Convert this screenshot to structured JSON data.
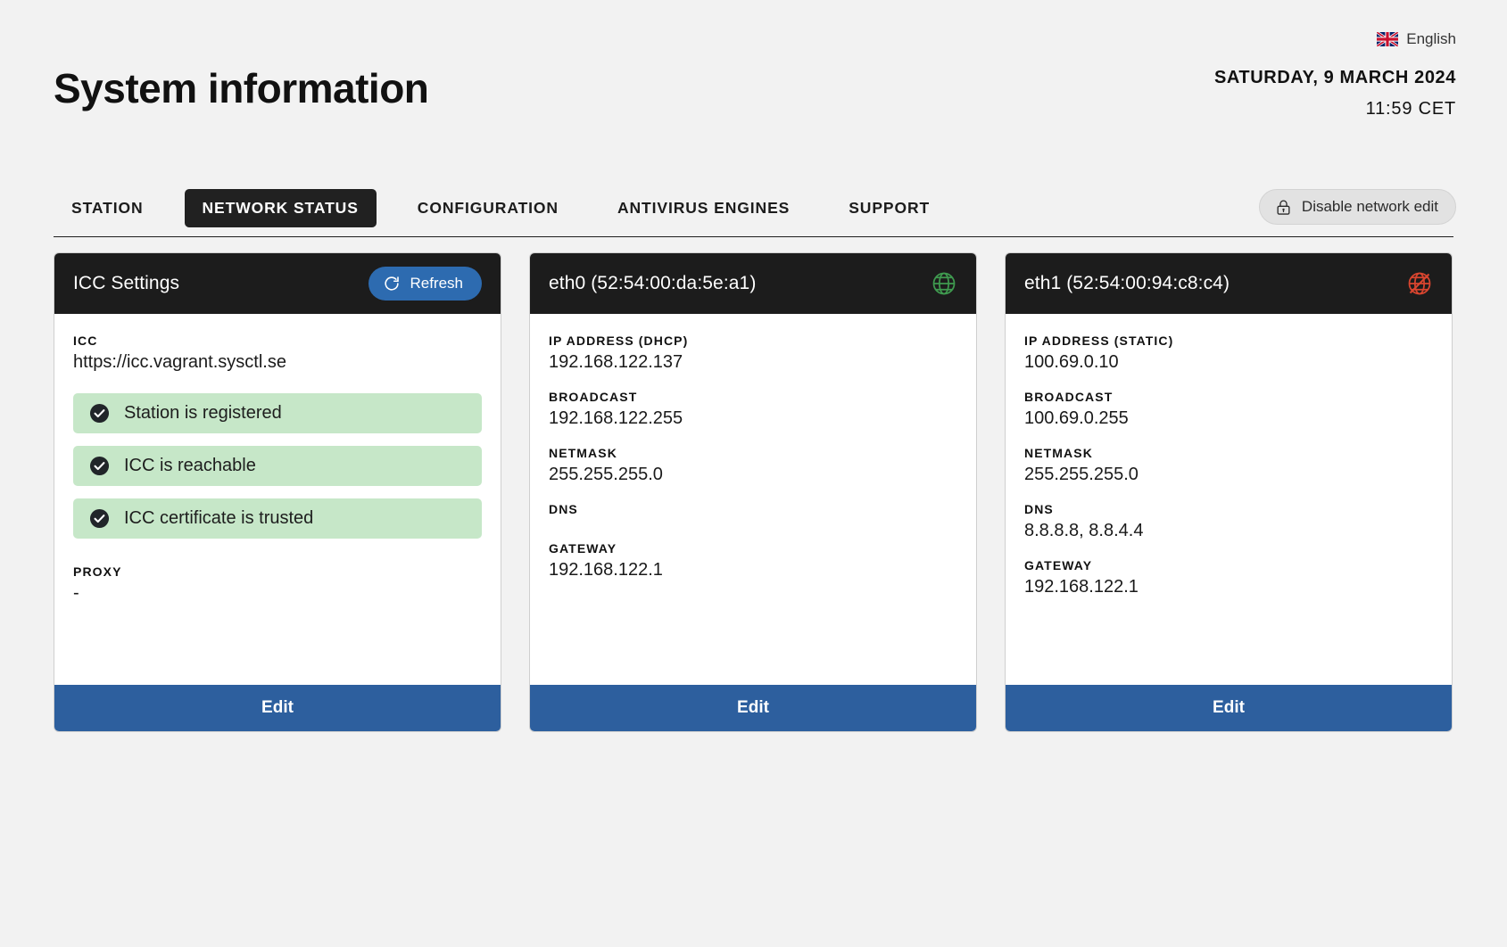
{
  "header": {
    "title": "System information",
    "language": "English",
    "language_flag_icon": "uk-flag-icon",
    "date": "SATURDAY, 9 MARCH 2024",
    "time": "11:59 CET"
  },
  "tabs": [
    {
      "label": "STATION",
      "active": false
    },
    {
      "label": "NETWORK STATUS",
      "active": true
    },
    {
      "label": "CONFIGURATION",
      "active": false
    },
    {
      "label": "ANTIVIRUS ENGINES",
      "active": false
    },
    {
      "label": "SUPPORT",
      "active": false
    }
  ],
  "network_edit_button": {
    "label": "Disable network edit",
    "icon": "lock-icon"
  },
  "cards": {
    "icc": {
      "title": "ICC Settings",
      "refresh_label": "Refresh",
      "refresh_icon": "refresh-icon",
      "icc_label": "ICC",
      "icc_value": "https://icc.vagrant.sysctl.se",
      "statuses": [
        {
          "label": "Station is registered",
          "icon": "check-circle-icon"
        },
        {
          "label": "ICC is reachable",
          "icon": "check-circle-icon"
        },
        {
          "label": "ICC certificate is trusted",
          "icon": "check-circle-icon"
        }
      ],
      "proxy_label": "PROXY",
      "proxy_value": "-",
      "edit_label": "Edit"
    },
    "eth0": {
      "title": "eth0 (52:54:00:da:5e:a1)",
      "status_icon": "globe-online-icon",
      "fields": [
        {
          "label": "IP ADDRESS (DHCP)",
          "value": "192.168.122.137"
        },
        {
          "label": "BROADCAST",
          "value": "192.168.122.255"
        },
        {
          "label": "NETMASK",
          "value": "255.255.255.0"
        },
        {
          "label": "DNS",
          "value": ""
        },
        {
          "label": "GATEWAY",
          "value": "192.168.122.1"
        }
      ],
      "edit_label": "Edit"
    },
    "eth1": {
      "title": "eth1 (52:54:00:94:c8:c4)",
      "status_icon": "globe-offline-icon",
      "fields": [
        {
          "label": "IP ADDRESS (STATIC)",
          "value": "100.69.0.10"
        },
        {
          "label": "BROADCAST",
          "value": "100.69.0.255"
        },
        {
          "label": "NETMASK",
          "value": "255.255.255.0"
        },
        {
          "label": "DNS",
          "value": "8.8.8.8, 8.8.4.4"
        },
        {
          "label": "GATEWAY",
          "value": "192.168.122.1"
        }
      ],
      "edit_label": "Edit"
    }
  },
  "colors": {
    "page_background": "#f2f2f2",
    "card_header": "#1c1c1c",
    "accent_blue": "#2d5f9e",
    "refresh_blue": "#2d6bb0",
    "status_green": "#c6e7c8",
    "online_green": "#3f9a4f",
    "offline_red": "#d9452f"
  }
}
